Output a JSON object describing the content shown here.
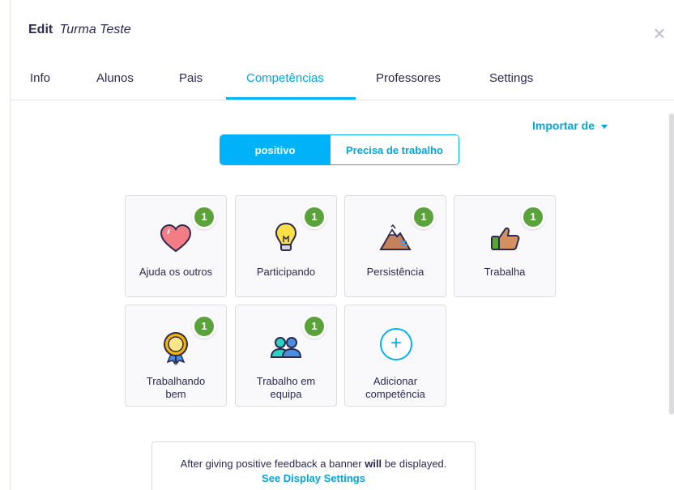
{
  "header": {
    "edit_label": "Edit",
    "class_name": "Turma Teste",
    "close_icon": "×"
  },
  "tabs": [
    {
      "label": "Info",
      "active": false
    },
    {
      "label": "Alunos",
      "active": false
    },
    {
      "label": "Pais",
      "active": false
    },
    {
      "label": "Competências",
      "active": true
    },
    {
      "label": "Professores",
      "active": false
    },
    {
      "label": "Settings",
      "active": false
    }
  ],
  "import": {
    "label": "Importar de"
  },
  "toggle": {
    "positive_label": "positivo",
    "negative_label": "Precisa de trabalho",
    "selected": "positivo"
  },
  "skills": [
    {
      "label": "Ajuda os outros",
      "count": "1",
      "icon": "heart-icon"
    },
    {
      "label": "Participando",
      "count": "1",
      "icon": "lightbulb-icon"
    },
    {
      "label": "Persistência",
      "count": "1",
      "icon": "mountain-icon"
    },
    {
      "label": "Trabalha",
      "count": "1",
      "icon": "thumbs-up-icon"
    },
    {
      "label_line1": "Trabalhando",
      "label_line2": "bem",
      "count": "1",
      "icon": "medal-icon"
    },
    {
      "label_line1": "Trabalho em",
      "label_line2": "equipa",
      "count": "1",
      "icon": "team-icon"
    }
  ],
  "add_skill": {
    "label_line1": "Adicionar",
    "label_line2": "competência",
    "icon": "plus-icon"
  },
  "banner": {
    "msg_before": "After giving positive feedback a banner ",
    "msg_bold": "will",
    "msg_after": " be displayed.",
    "link": "See Display Settings"
  },
  "colors": {
    "accent": "#00b2f7",
    "badge": "#5aa33a",
    "text": "#2c2a50"
  }
}
